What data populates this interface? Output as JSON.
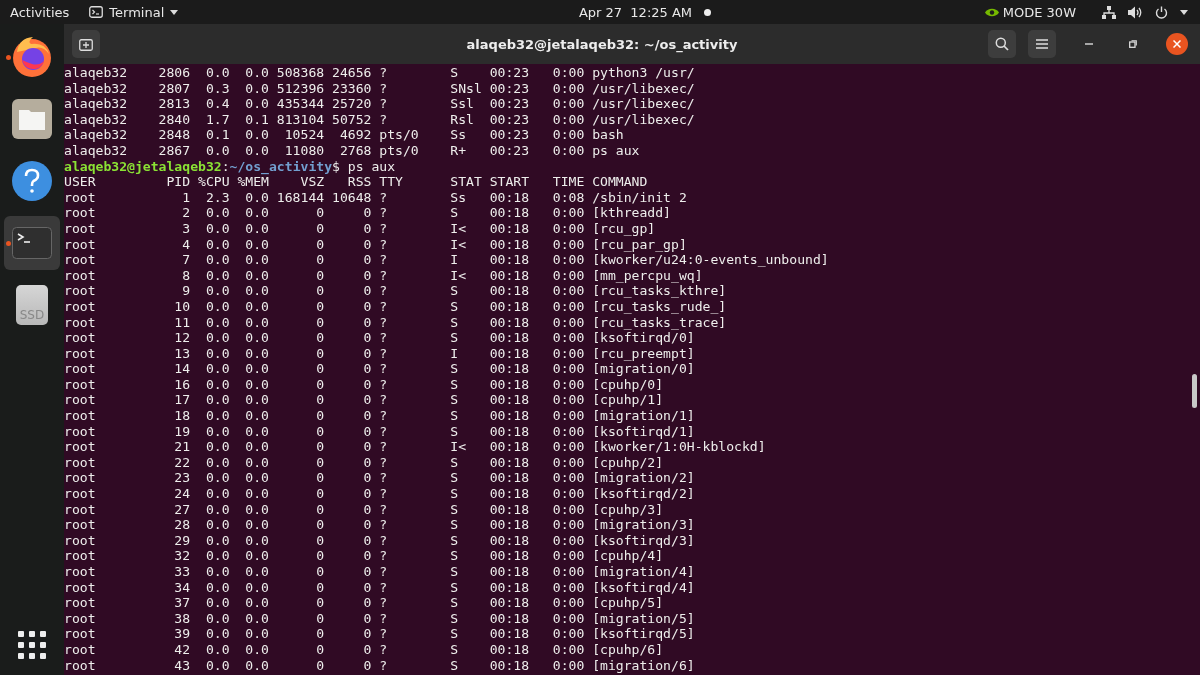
{
  "top_bar": {
    "activities": "Activities",
    "app_menu": "Terminal",
    "clock": "Apr 27  12:25 AM",
    "notification_dot": true,
    "gpu_mode": "MODE 30W"
  },
  "dock": {
    "items": [
      {
        "kind": "firefox",
        "running": true,
        "selected": false
      },
      {
        "kind": "files",
        "running": false,
        "selected": false
      },
      {
        "kind": "help",
        "running": false,
        "selected": false
      },
      {
        "kind": "terminal",
        "running": true,
        "selected": true
      },
      {
        "kind": "drive",
        "label": "SSD",
        "running": false,
        "selected": false
      }
    ]
  },
  "window": {
    "title": "alaqeb32@jetalaqeb32: ~/os_activity"
  },
  "terminal": {
    "output_before": [
      "alaqeb32    2806  0.0  0.0 508368 24656 ?        S    00:23   0:00 python3 /usr/",
      "alaqeb32    2807  0.3  0.0 512396 23360 ?        SNsl 00:23   0:00 /usr/libexec/",
      "alaqeb32    2813  0.4  0.0 435344 25720 ?        Ssl  00:23   0:00 /usr/libexec/",
      "alaqeb32    2840  1.7  0.1 813104 50752 ?        Rsl  00:23   0:00 /usr/libexec/",
      "alaqeb32    2848  0.1  0.0  10524  4692 pts/0    Ss   00:23   0:00 bash",
      "alaqeb32    2867  0.0  0.0  11080  2768 pts/0    R+   00:23   0:00 ps aux"
    ],
    "prompt": {
      "user_host": "alaqeb32@jetalaqeb32",
      "separator": ":",
      "path": "~/os_activity",
      "symbol": "$",
      "command": " ps aux"
    },
    "output": [
      "USER         PID %CPU %MEM    VSZ   RSS TTY      STAT START   TIME COMMAND",
      "root           1  2.3  0.0 168144 10648 ?        Ss   00:18   0:08 /sbin/init 2",
      "root           2  0.0  0.0      0     0 ?        S    00:18   0:00 [kthreadd]",
      "root           3  0.0  0.0      0     0 ?        I<   00:18   0:00 [rcu_gp]",
      "root           4  0.0  0.0      0     0 ?        I<   00:18   0:00 [rcu_par_gp]",
      "root           7  0.0  0.0      0     0 ?        I    00:18   0:00 [kworker/u24:0-events_unbound]",
      "root           8  0.0  0.0      0     0 ?        I<   00:18   0:00 [mm_percpu_wq]",
      "root           9  0.0  0.0      0     0 ?        S    00:18   0:00 [rcu_tasks_kthre]",
      "root          10  0.0  0.0      0     0 ?        S    00:18   0:00 [rcu_tasks_rude_]",
      "root          11  0.0  0.0      0     0 ?        S    00:18   0:00 [rcu_tasks_trace]",
      "root          12  0.0  0.0      0     0 ?        S    00:18   0:00 [ksoftirqd/0]",
      "root          13  0.0  0.0      0     0 ?        I    00:18   0:00 [rcu_preempt]",
      "root          14  0.0  0.0      0     0 ?        S    00:18   0:00 [migration/0]",
      "root          16  0.0  0.0      0     0 ?        S    00:18   0:00 [cpuhp/0]",
      "root          17  0.0  0.0      0     0 ?        S    00:18   0:00 [cpuhp/1]",
      "root          18  0.0  0.0      0     0 ?        S    00:18   0:00 [migration/1]",
      "root          19  0.0  0.0      0     0 ?        S    00:18   0:00 [ksoftirqd/1]",
      "root          21  0.0  0.0      0     0 ?        I<   00:18   0:00 [kworker/1:0H-kblockd]",
      "root          22  0.0  0.0      0     0 ?        S    00:18   0:00 [cpuhp/2]",
      "root          23  0.0  0.0      0     0 ?        S    00:18   0:00 [migration/2]",
      "root          24  0.0  0.0      0     0 ?        S    00:18   0:00 [ksoftirqd/2]",
      "root          27  0.0  0.0      0     0 ?        S    00:18   0:00 [cpuhp/3]",
      "root          28  0.0  0.0      0     0 ?        S    00:18   0:00 [migration/3]",
      "root          29  0.0  0.0      0     0 ?        S    00:18   0:00 [ksoftirqd/3]",
      "root          32  0.0  0.0      0     0 ?        S    00:18   0:00 [cpuhp/4]",
      "root          33  0.0  0.0      0     0 ?        S    00:18   0:00 [migration/4]",
      "root          34  0.0  0.0      0     0 ?        S    00:18   0:00 [ksoftirqd/4]",
      "root          37  0.0  0.0      0     0 ?        S    00:18   0:00 [cpuhp/5]",
      "root          38  0.0  0.0      0     0 ?        S    00:18   0:00 [migration/5]",
      "root          39  0.0  0.0      0     0 ?        S    00:18   0:00 [ksoftirqd/5]",
      "root          42  0.0  0.0      0     0 ?        S    00:18   0:00 [cpuhp/6]",
      "root          43  0.0  0.0      0     0 ?        S    00:18   0:00 [migration/6]"
    ]
  }
}
